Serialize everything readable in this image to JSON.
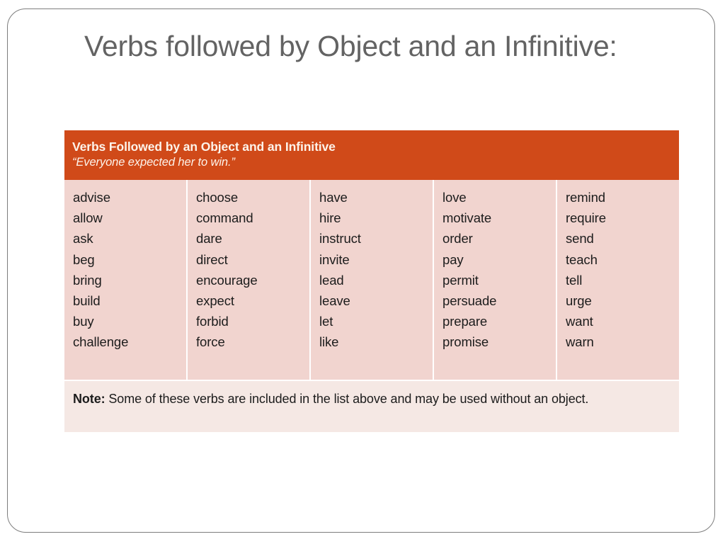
{
  "slide": {
    "title": "Verbs followed by Object and an Infinitive:"
  },
  "table": {
    "header_title": "Verbs Followed by an Object and an Infinitive",
    "header_example": "“Everyone expected her to win.”",
    "columns": [
      [
        "advise",
        "allow",
        "ask",
        "beg",
        "bring",
        "build",
        "buy",
        "challenge"
      ],
      [
        "choose",
        "command",
        "dare",
        "direct",
        "encourage",
        "expect",
        "forbid",
        "force"
      ],
      [
        "have",
        "hire",
        "instruct",
        "invite",
        "lead",
        "leave",
        "let",
        "like"
      ],
      [
        "love",
        "motivate",
        "order",
        "pay",
        "permit",
        "persuade",
        "prepare",
        "promise"
      ],
      [
        "remind",
        "require",
        "send",
        "teach",
        "tell",
        "urge",
        "want",
        "warn"
      ]
    ],
    "note_label": "Note:",
    "note_body": " Some of these verbs are included in the list above and may be used without an object."
  },
  "colors": {
    "header_orange": "#d04a19",
    "cell_pink": "#f1d4cf",
    "note_pink": "#f5e8e4",
    "header_text": "#fdf3ea",
    "title_gray": "#636363",
    "body_text": "#1c1c1c",
    "slide_border": "#7d7d7d"
  }
}
